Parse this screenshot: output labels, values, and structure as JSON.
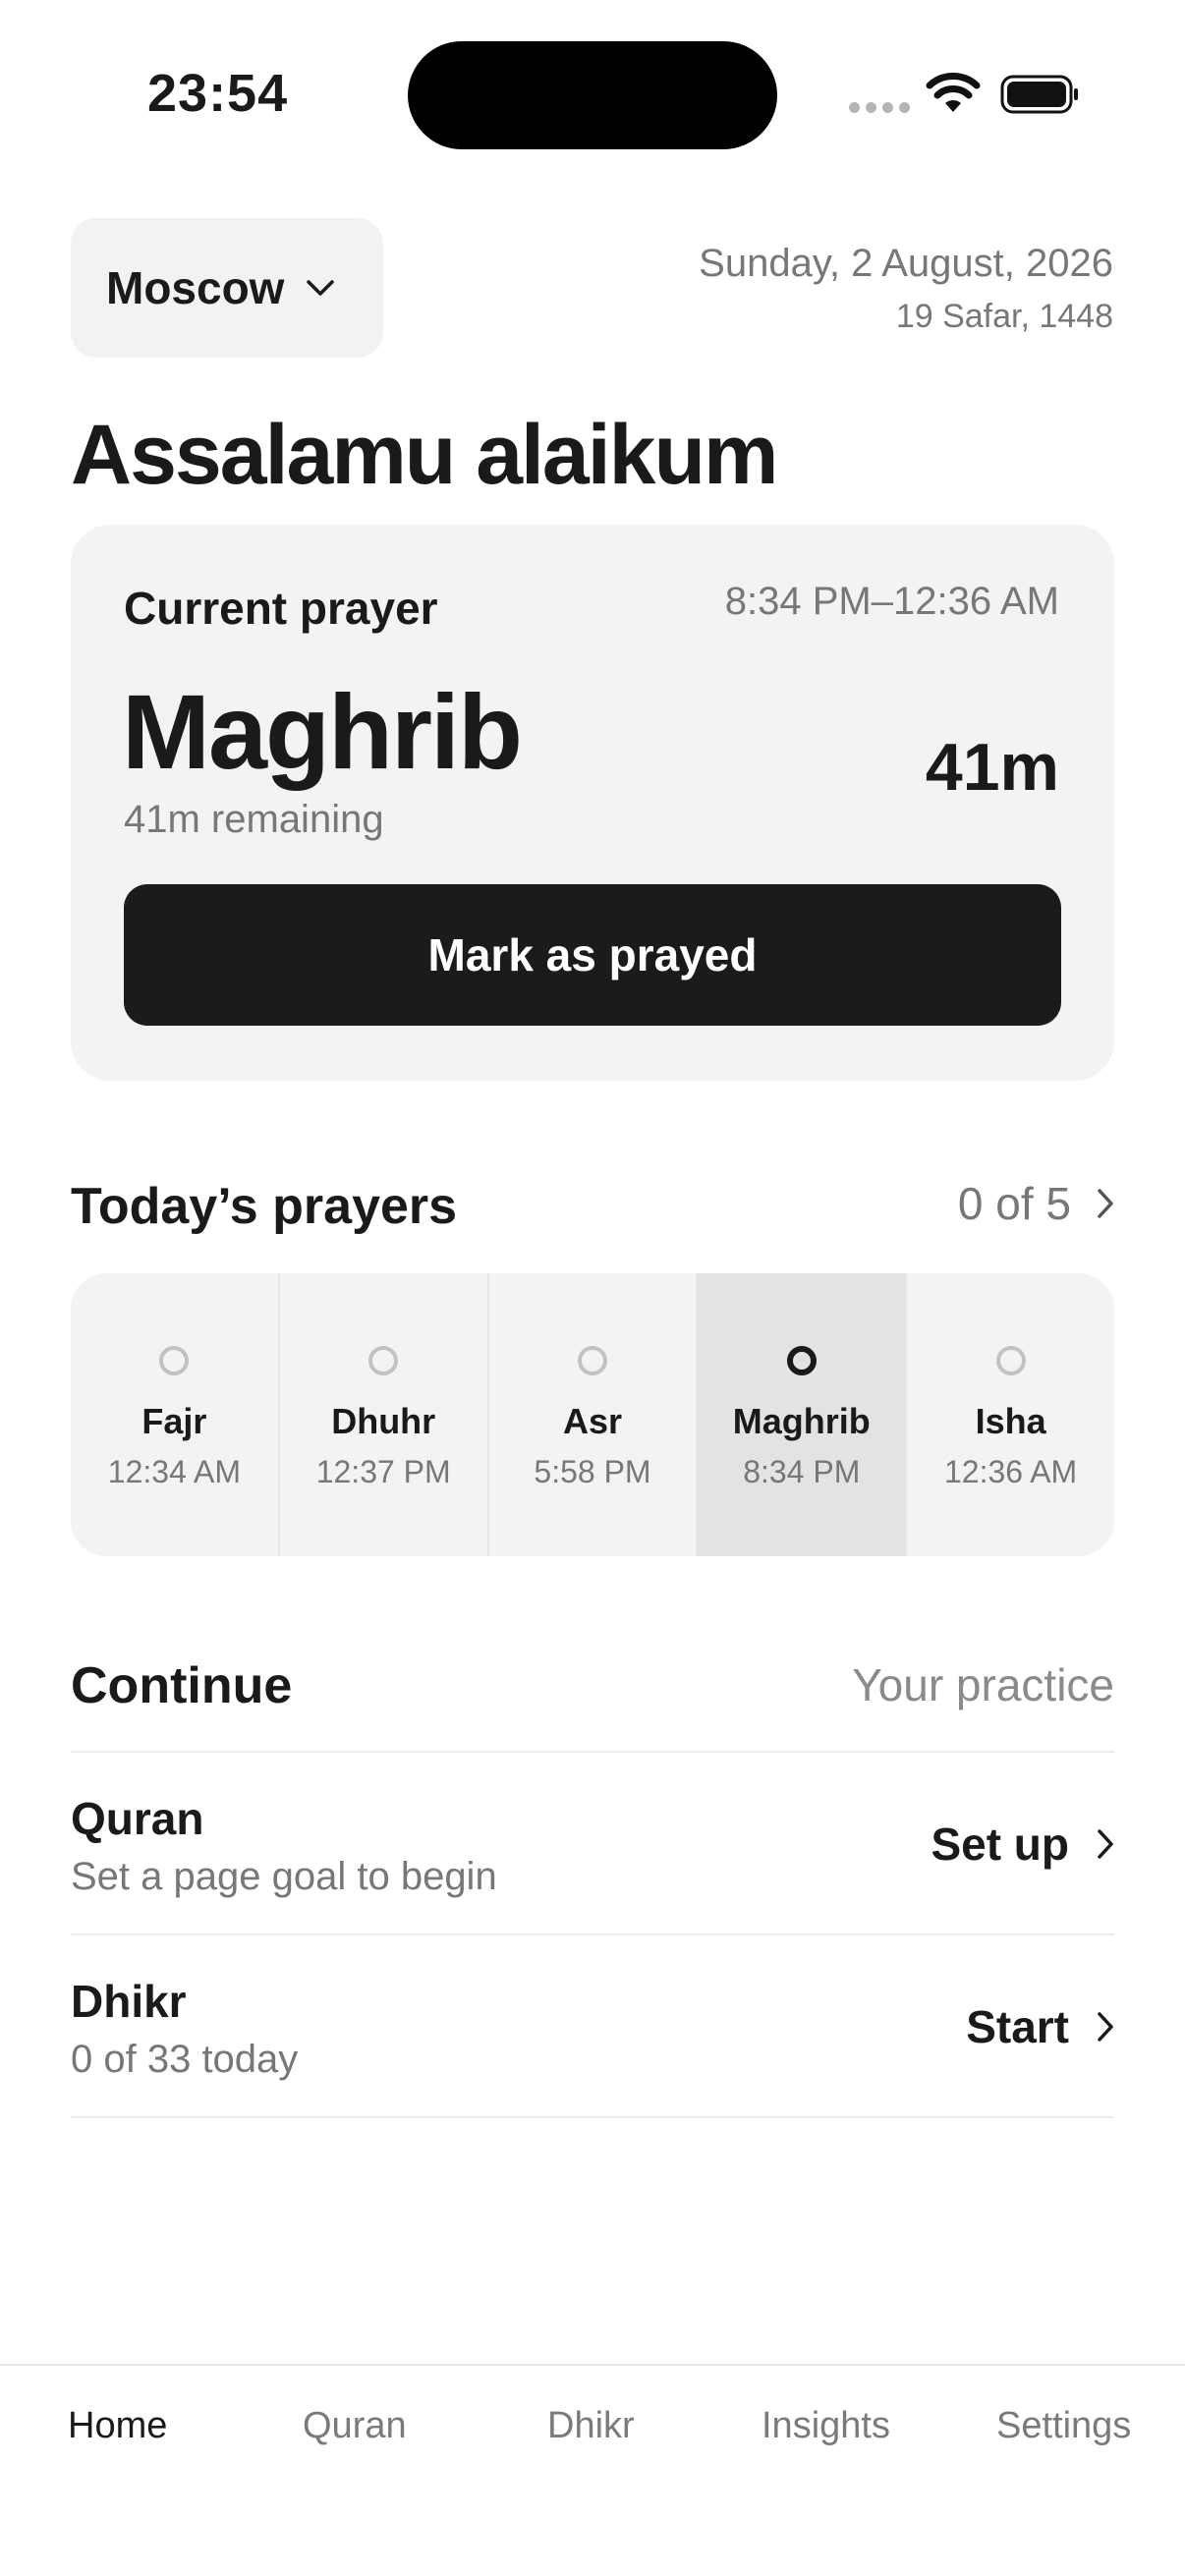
{
  "status_bar": {
    "time": "23:54"
  },
  "header": {
    "city": "Moscow",
    "date": "Sunday, 2 August, 2026",
    "hijri_date": "19 Safar, 1448"
  },
  "greeting": "Assalamu alaikum",
  "current_prayer": {
    "label": "Current prayer",
    "range": "8:34 PM–12:36 AM",
    "name": "Maghrib",
    "countdown": "41m",
    "remaining": "41m remaining",
    "button": "Mark as prayed"
  },
  "todays_prayers": {
    "title": "Today’s prayers",
    "progress": "0 of 5",
    "items": [
      {
        "name": "Fajr",
        "time": "12:34 AM"
      },
      {
        "name": "Dhuhr",
        "time": "12:37 PM"
      },
      {
        "name": "Asr",
        "time": "5:58 PM"
      },
      {
        "name": "Maghrib",
        "time": "8:34 PM"
      },
      {
        "name": "Isha",
        "time": "12:36 AM"
      }
    ]
  },
  "continue": {
    "title": "Continue",
    "subtitle": "Your practice",
    "items": [
      {
        "title": "Quran",
        "subtitle": "Set a page goal to begin",
        "action": "Set up"
      },
      {
        "title": "Dhikr",
        "subtitle": "0 of 33 today",
        "action": "Start"
      }
    ]
  },
  "tabs": [
    "Home",
    "Quran",
    "Dhikr",
    "Insights",
    "Settings"
  ]
}
